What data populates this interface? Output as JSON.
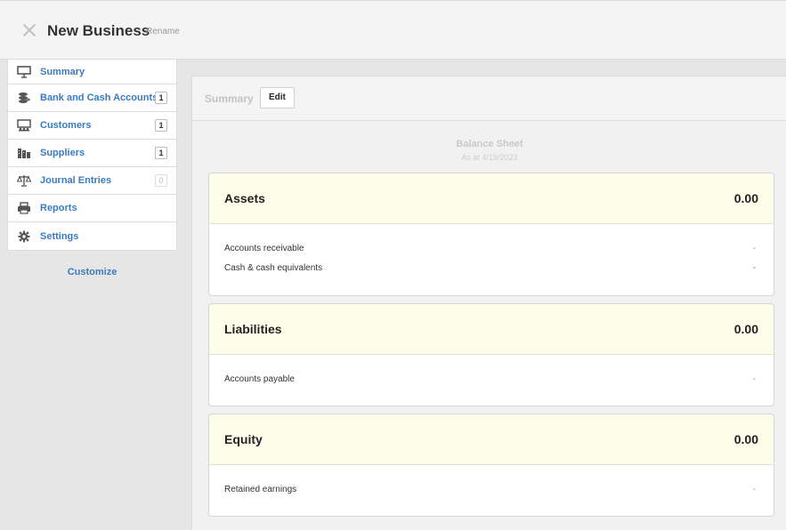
{
  "header": {
    "business_name": "New Business",
    "rename_label": "Rename"
  },
  "sidebar": {
    "items": [
      {
        "label": "Summary",
        "icon": "presentation-icon"
      },
      {
        "label": "Bank and Cash Accounts",
        "icon": "coins-icon",
        "count": "1"
      },
      {
        "label": "Customers",
        "icon": "customers-icon",
        "count": "1"
      },
      {
        "label": "Suppliers",
        "icon": "suppliers-icon",
        "count": "1"
      },
      {
        "label": "Journal Entries",
        "icon": "scales-icon",
        "count": "0"
      },
      {
        "label": "Reports",
        "icon": "printer-icon"
      },
      {
        "label": "Settings",
        "icon": "gear-icon"
      }
    ],
    "customize_label": "Customize"
  },
  "main": {
    "breadcrumb": "Summary",
    "edit_label": "Edit",
    "report_title": "Balance Sheet",
    "report_date": "As at 4/19/2023",
    "sections": [
      {
        "title": "Assets",
        "total": "0.00",
        "rows": [
          {
            "label": "Accounts receivable",
            "value": "-"
          },
          {
            "label": "Cash & cash equivalents",
            "value": "-"
          }
        ]
      },
      {
        "title": "Liabilities",
        "total": "0.00",
        "rows": [
          {
            "label": "Accounts payable",
            "value": "-"
          }
        ]
      },
      {
        "title": "Equity",
        "total": "0.00",
        "rows": [
          {
            "label": "Retained earnings",
            "value": "-"
          }
        ]
      }
    ]
  },
  "colors": {
    "link": "#3a7bbf",
    "card_header": "#fdfde9"
  }
}
